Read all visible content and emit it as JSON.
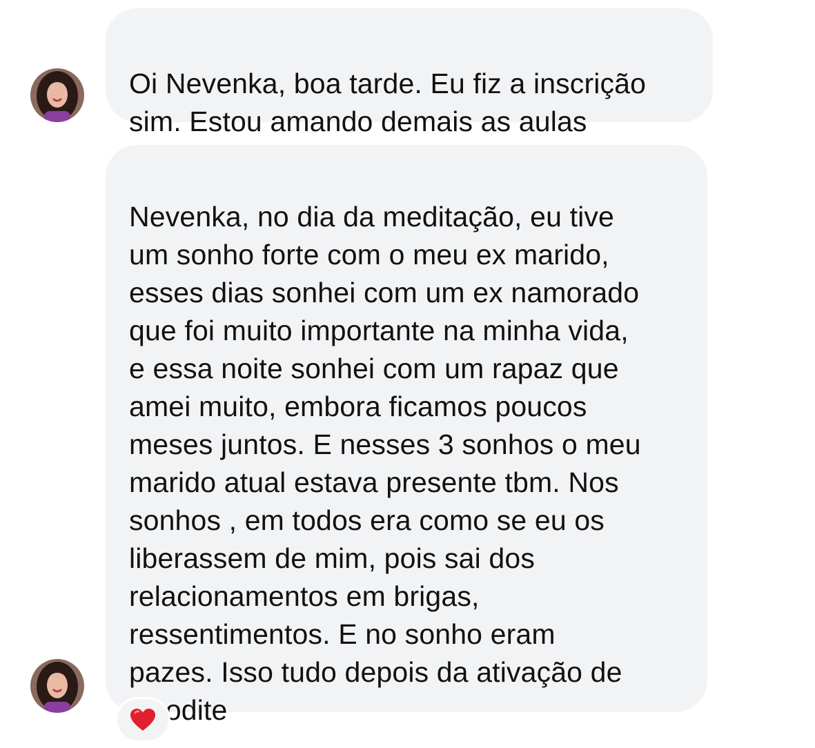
{
  "conversation": {
    "messages": [
      {
        "text": "Oi Nevenka, boa tarde. Eu fiz a inscrição\nsim. Estou amando demais as aulas"
      },
      {
        "text": "Nevenka, no dia da meditação, eu tive\num sonho forte com o meu ex marido,\nesses dias sonhei com um ex namorado\nque foi muito importante na minha vida,\ne essa noite sonhei com um rapaz que\namei muito, embora ficamos poucos\nmeses juntos. E nesses 3 sonhos o meu\nmarido atual estava presente tbm. Nos\nsonhos , em todos era como se eu os\nliberassem de mim, pois sai dos\nrelacionamentos em brigas,\nressentimentos. E no sonho eram\npazes. Isso tudo depois da ativação de\nAfrodite",
        "reaction": "heart-icon"
      }
    ]
  },
  "colors": {
    "bubble_background": "#f2f3f5",
    "text": "#111111",
    "reaction_heart": "#e0202e"
  }
}
